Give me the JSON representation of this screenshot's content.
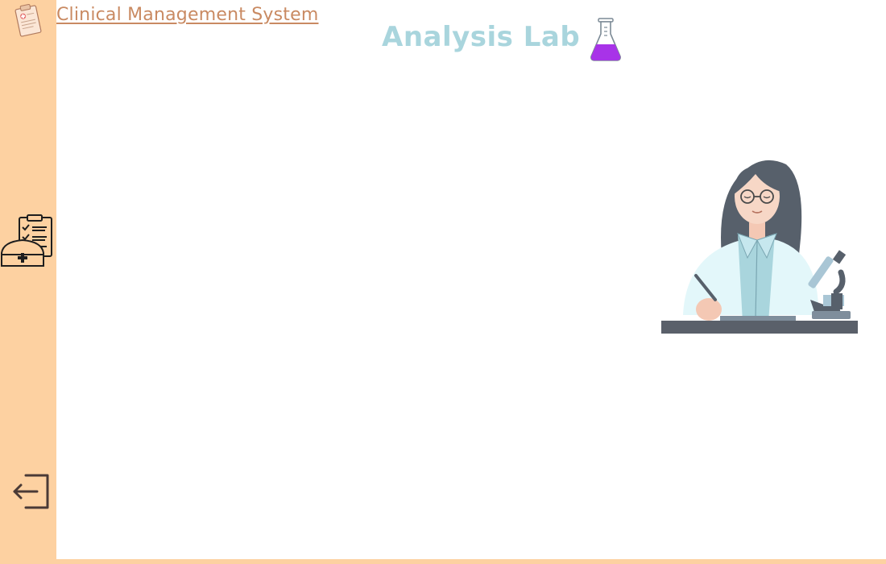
{
  "app": {
    "title": "Clinical Management System"
  },
  "page": {
    "title": "Analysis Lab"
  },
  "icons": {
    "logo": "clipboard-prescription-icon",
    "flask": "flask-icon",
    "nav": "nurse-clipboard-icon",
    "logout": "logout-icon",
    "illustration": "lab-scientist-microscope-illustration"
  },
  "colors": {
    "sidebar": "#fdd1a1",
    "app_title": "#c98a62",
    "page_title": "#a9d5dd",
    "flask_liquid": "#a833e8"
  }
}
